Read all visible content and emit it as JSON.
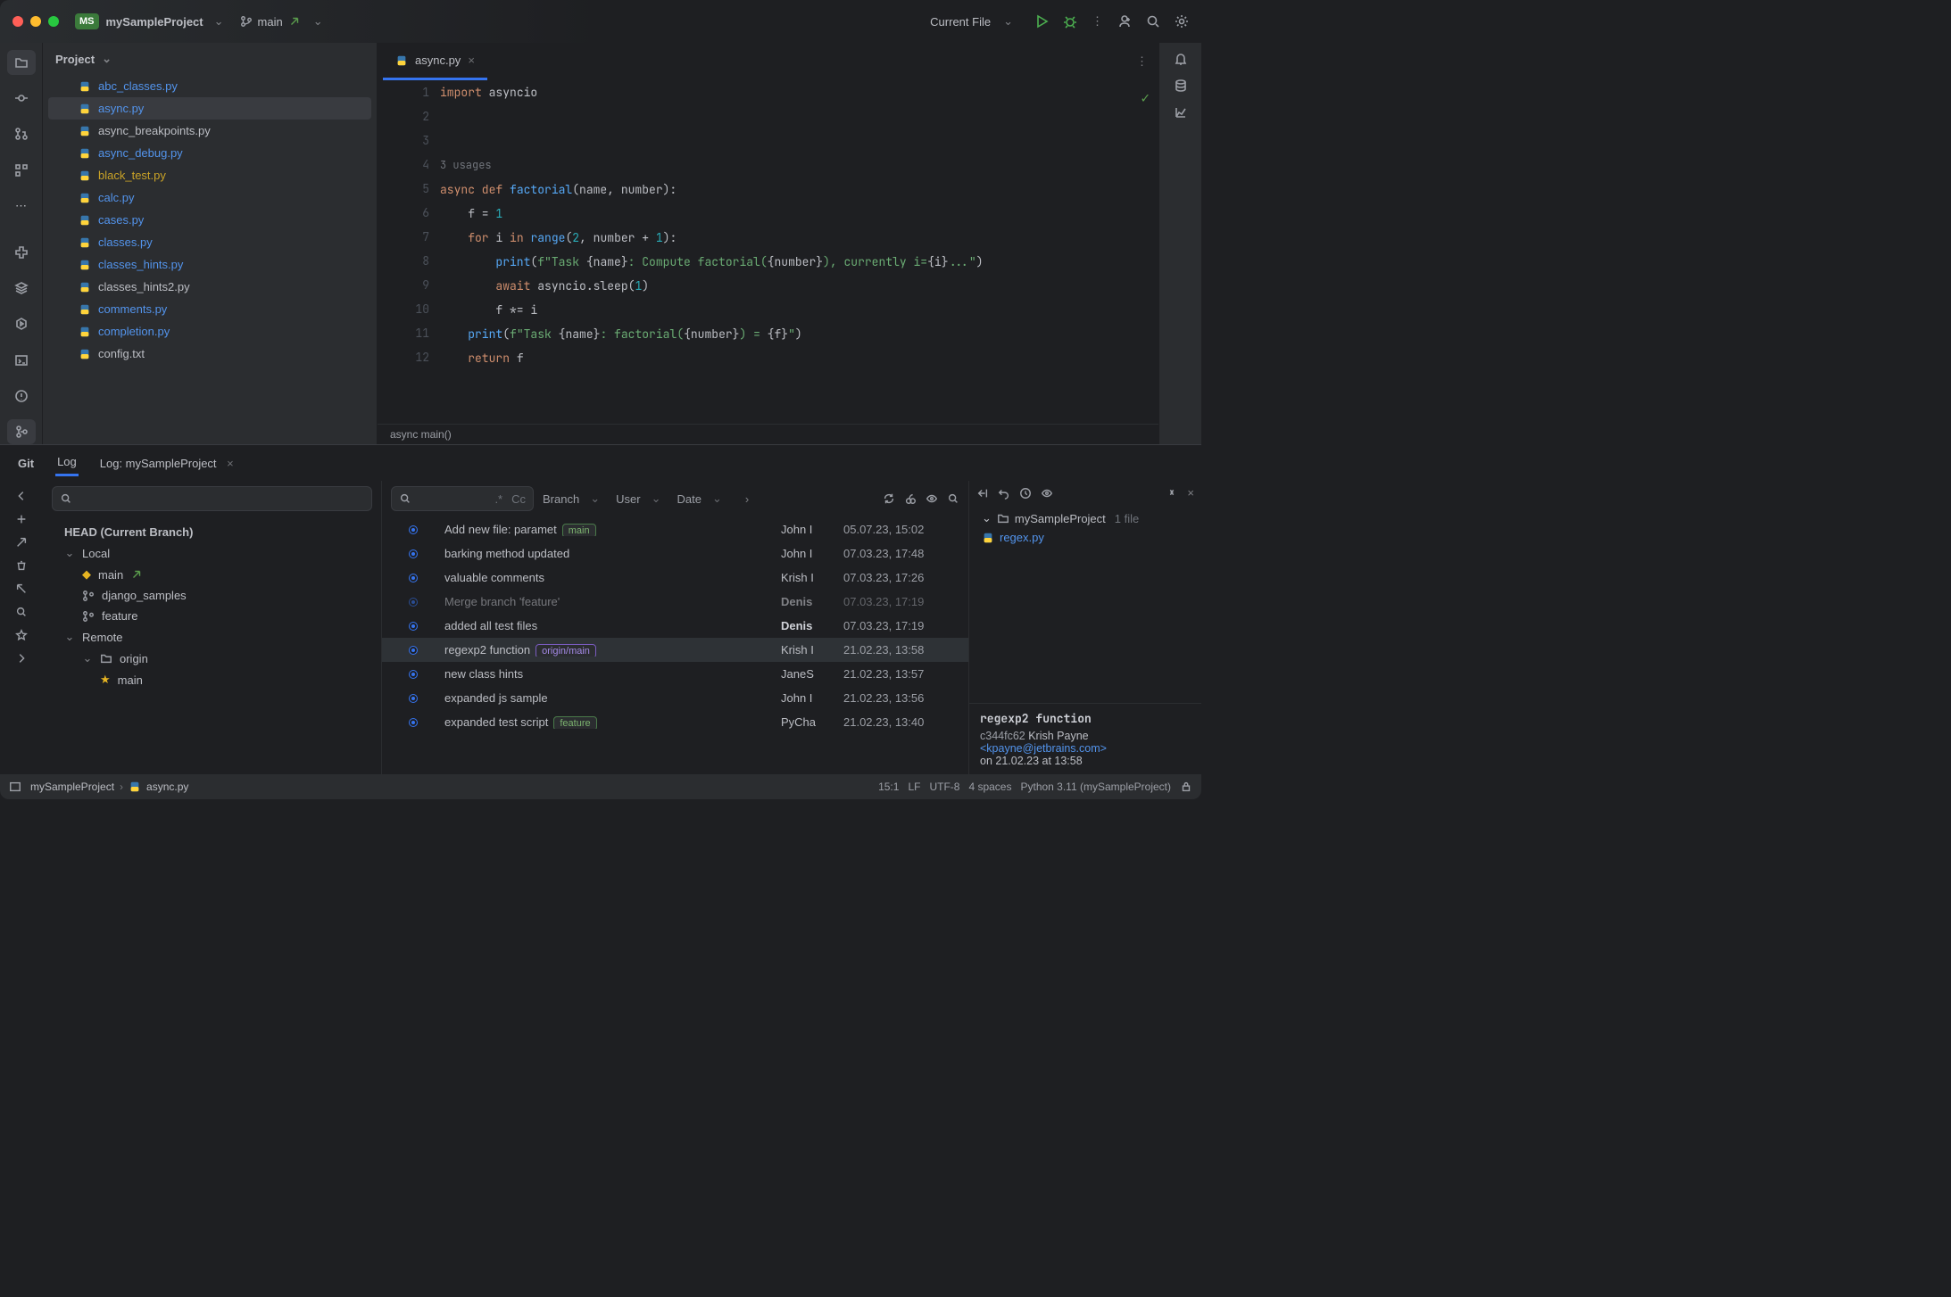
{
  "titlebar": {
    "project": "mySampleProject",
    "project_badge": "MS",
    "branch": "main",
    "run_config": "Current File"
  },
  "project_panel": {
    "title": "Project",
    "files": [
      {
        "name": "abc_classes.py",
        "style": "blue"
      },
      {
        "name": "async.py",
        "style": "blue",
        "selected": true
      },
      {
        "name": "async_breakpoints.py",
        "style": "plain"
      },
      {
        "name": "async_debug.py",
        "style": "blue"
      },
      {
        "name": "black_test.py",
        "style": "gold"
      },
      {
        "name": "calc.py",
        "style": "blue"
      },
      {
        "name": "cases.py",
        "style": "blue"
      },
      {
        "name": "classes.py",
        "style": "blue"
      },
      {
        "name": "classes_hints.py",
        "style": "blue"
      },
      {
        "name": "classes_hints2.py",
        "style": "plain"
      },
      {
        "name": "comments.py",
        "style": "blue"
      },
      {
        "name": "completion.py",
        "style": "blue"
      },
      {
        "name": "config.txt",
        "style": "plain"
      }
    ]
  },
  "editor": {
    "tab": "async.py",
    "usages_hint": "3 usages",
    "lines": [
      "1",
      "2",
      "3",
      "",
      "4",
      "5",
      "6",
      "7",
      "8",
      "9",
      "10",
      "11",
      "12"
    ],
    "breadcrumb": "async main()"
  },
  "git": {
    "tabs": {
      "git": "Git",
      "log": "Log",
      "log_project": "Log: mySampleProject"
    },
    "branches": {
      "head": "HEAD (Current Branch)",
      "local_label": "Local",
      "remote_label": "Remote",
      "local": [
        "main",
        "django_samples",
        "feature"
      ],
      "origin_label": "origin",
      "origin": [
        "main"
      ]
    },
    "filters": {
      "branch": "Branch",
      "user": "User",
      "date": "Date",
      "regex": ".*",
      "case": "Cc"
    },
    "commits": [
      {
        "msg": "Add new file: paramet",
        "tag": "main",
        "tagStyle": "green",
        "author": "John I",
        "date": "05.07.23, 15:02"
      },
      {
        "msg": "barking method updated",
        "author": "John I",
        "date": "07.03.23, 17:48"
      },
      {
        "msg": "valuable comments",
        "author": "Krish I",
        "date": "07.03.23, 17:26"
      },
      {
        "msg": "Merge branch 'feature'",
        "author": "Denis",
        "date": "07.03.23, 17:19",
        "muted": true,
        "bold": true
      },
      {
        "msg": "added all test files",
        "author": "Denis",
        "date": "07.03.23, 17:19",
        "bold": true
      },
      {
        "msg": "regexp2 function",
        "tag": "origin/main",
        "tagStyle": "purple",
        "author": "Krish I",
        "date": "21.02.23, 13:58",
        "selected": true
      },
      {
        "msg": "new class hints",
        "author": "JaneS",
        "date": "21.02.23, 13:57"
      },
      {
        "msg": "expanded js sample",
        "author": "John I",
        "date": "21.02.23, 13:56"
      },
      {
        "msg": "expanded test script",
        "tag": "feature",
        "tagStyle": "green",
        "author": "PyCha",
        "date": "21.02.23, 13:40"
      }
    ],
    "details": {
      "project": "mySampleProject",
      "file_count": "1 file",
      "changed_file": "regex.py",
      "title": "regexp2 function",
      "hash": "c344fc62",
      "author_name": "Krish Payne",
      "author_email": "<kpayne@jetbrains.com>",
      "on_line": "on 21.02.23 at 13:58"
    }
  },
  "statusbar": {
    "crumb_project": "mySampleProject",
    "crumb_file": "async.py",
    "caret": "15:1",
    "line_sep": "LF",
    "encoding": "UTF-8",
    "indent": "4 spaces",
    "interpreter": "Python 3.11 (mySampleProject)"
  }
}
